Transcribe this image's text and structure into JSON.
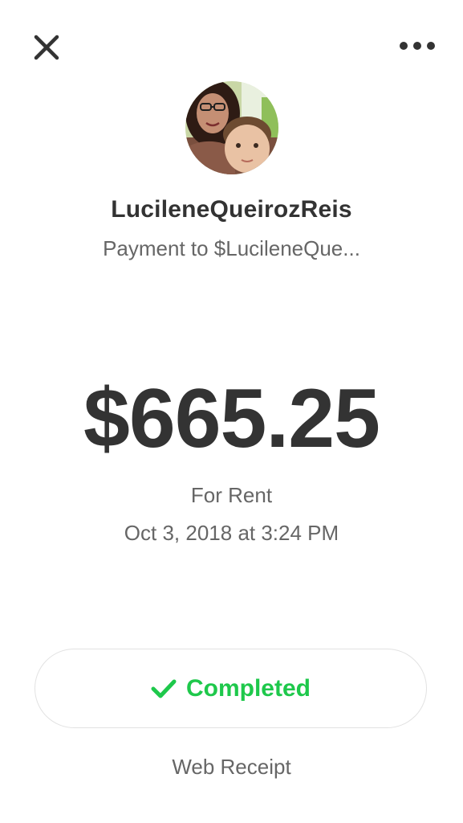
{
  "header": {
    "close_icon": "close-icon",
    "more_icon": "more-horizontal-icon"
  },
  "recipient": {
    "name": "LucileneQueirozReis",
    "payment_line": "Payment to $LucileneQue..."
  },
  "payment": {
    "amount": "$665.25",
    "note": "For Rent",
    "date": "Oct 3, 2018 at 3:24 PM"
  },
  "status": {
    "label": "Completed",
    "icon": "checkmark-icon",
    "color": "#1ec84b"
  },
  "footer": {
    "receipt_link": "Web Receipt"
  }
}
